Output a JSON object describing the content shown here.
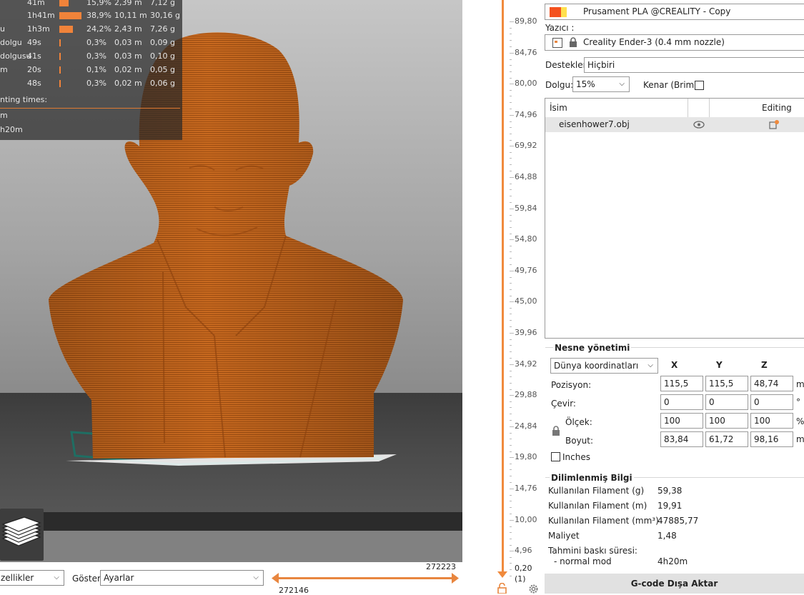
{
  "stats": {
    "rows": [
      {
        "name": "",
        "time": "41m",
        "pct": "15,9%",
        "len": "2,39 m",
        "wt": "7,12 g",
        "fill": 0.159
      },
      {
        "name": "",
        "time": "1h41m",
        "pct": "38,9%",
        "len": "10,11 m",
        "wt": "30,16 g",
        "fill": 0.389
      },
      {
        "name": "u",
        "time": "1h3m",
        "pct": "24,2%",
        "len": "2,43 m",
        "wt": "7,26 g",
        "fill": 0.242
      },
      {
        "name": "dolgu",
        "time": "49s",
        "pct": "0,3%",
        "len": "0,03 m",
        "wt": "0,09 g",
        "fill": 0.003
      },
      {
        "name": "dolgusu",
        "time": "41s",
        "pct": "0,3%",
        "len": "0,03 m",
        "wt": "0,10 g",
        "fill": 0.003
      },
      {
        "name": "m",
        "time": "20s",
        "pct": "0,1%",
        "len": "0,02 m",
        "wt": "0,05 g",
        "fill": 0.001
      },
      {
        "name": "",
        "time": "48s",
        "pct": "0,3%",
        "len": "0,02 m",
        "wt": "0,06 g",
        "fill": 0.003
      }
    ],
    "printing_times_label": "nting times:",
    "pt_row1": "m",
    "pt_row2": "h20m"
  },
  "bottom": {
    "view_select": "zellikler",
    "show_label": "Göster",
    "show_select": "Ayarlar",
    "h_slider_top": "272223",
    "h_slider_bottom": "272146"
  },
  "v_slider": {
    "ticks": [
      "89,80",
      "84,76",
      "80,00",
      "74,96",
      "69,92",
      "64,88",
      "59,84",
      "54,80",
      "49,76",
      "45,00",
      "39,96",
      "34,92",
      "29,88",
      "24,84",
      "19,80",
      "14,76",
      "10,00",
      "4,96"
    ],
    "top_value": "0,20",
    "top_sub": "(1)"
  },
  "panel": {
    "filament_name": "Prusament PLA @CREALITY - Copy",
    "printer_label": "Yazıcı :",
    "printer_name": "Creality Ender-3 (0.4 mm nozzle)",
    "supports_label": "Destekler:",
    "supports_value": "Hiçbiri",
    "infill_label": "Dolgu:",
    "infill_value": "15%",
    "brim_label": "Kenar (Brim):",
    "list_header_name": "İsim",
    "list_header_editing": "Editing",
    "object_name": "eisenhower7.obj",
    "obj_mgmt_title": "Nesne yönetimi",
    "coord_select": "Dünya koordinatları",
    "axis_x": "X",
    "axis_y": "Y",
    "axis_z": "Z",
    "pos_label": "Pozisyon:",
    "pos": [
      "115,5",
      "115,5",
      "48,74"
    ],
    "pos_unit": "m",
    "rot_label": "Çevir:",
    "rot": [
      "0",
      "0",
      "0"
    ],
    "rot_unit": "°",
    "scale_label": "Ölçek:",
    "scale": [
      "100",
      "100",
      "100"
    ],
    "scale_unit": "%",
    "size_label": "Boyut:",
    "size": [
      "83,84",
      "61,72",
      "98,16"
    ],
    "size_unit": "m",
    "inches_label": "Inches",
    "sliced_title": "Dilimlenmiş Bilgi",
    "fil_g_label": "Kullanılan Filament (g)",
    "fil_g": "59,38",
    "fil_m_label": "Kullanılan Filament (m)",
    "fil_m": "19,91",
    "fil_mm3_label": "Kullanılan Filament (mm³)",
    "fil_mm3": "47885,77",
    "cost_label": "Maliyet",
    "cost": "1,48",
    "est_label": "Tahmini baskı süresi:",
    "normal_mode_label": "- normal mod",
    "normal_mode_value": "4h20m",
    "export_label": "G-code Dışa Aktar"
  },
  "colors": {
    "accent": "#f08a3d",
    "model": "#c8691f",
    "filament_swatch": "#f4511e",
    "filament_swatch2": "#ffe04d"
  }
}
